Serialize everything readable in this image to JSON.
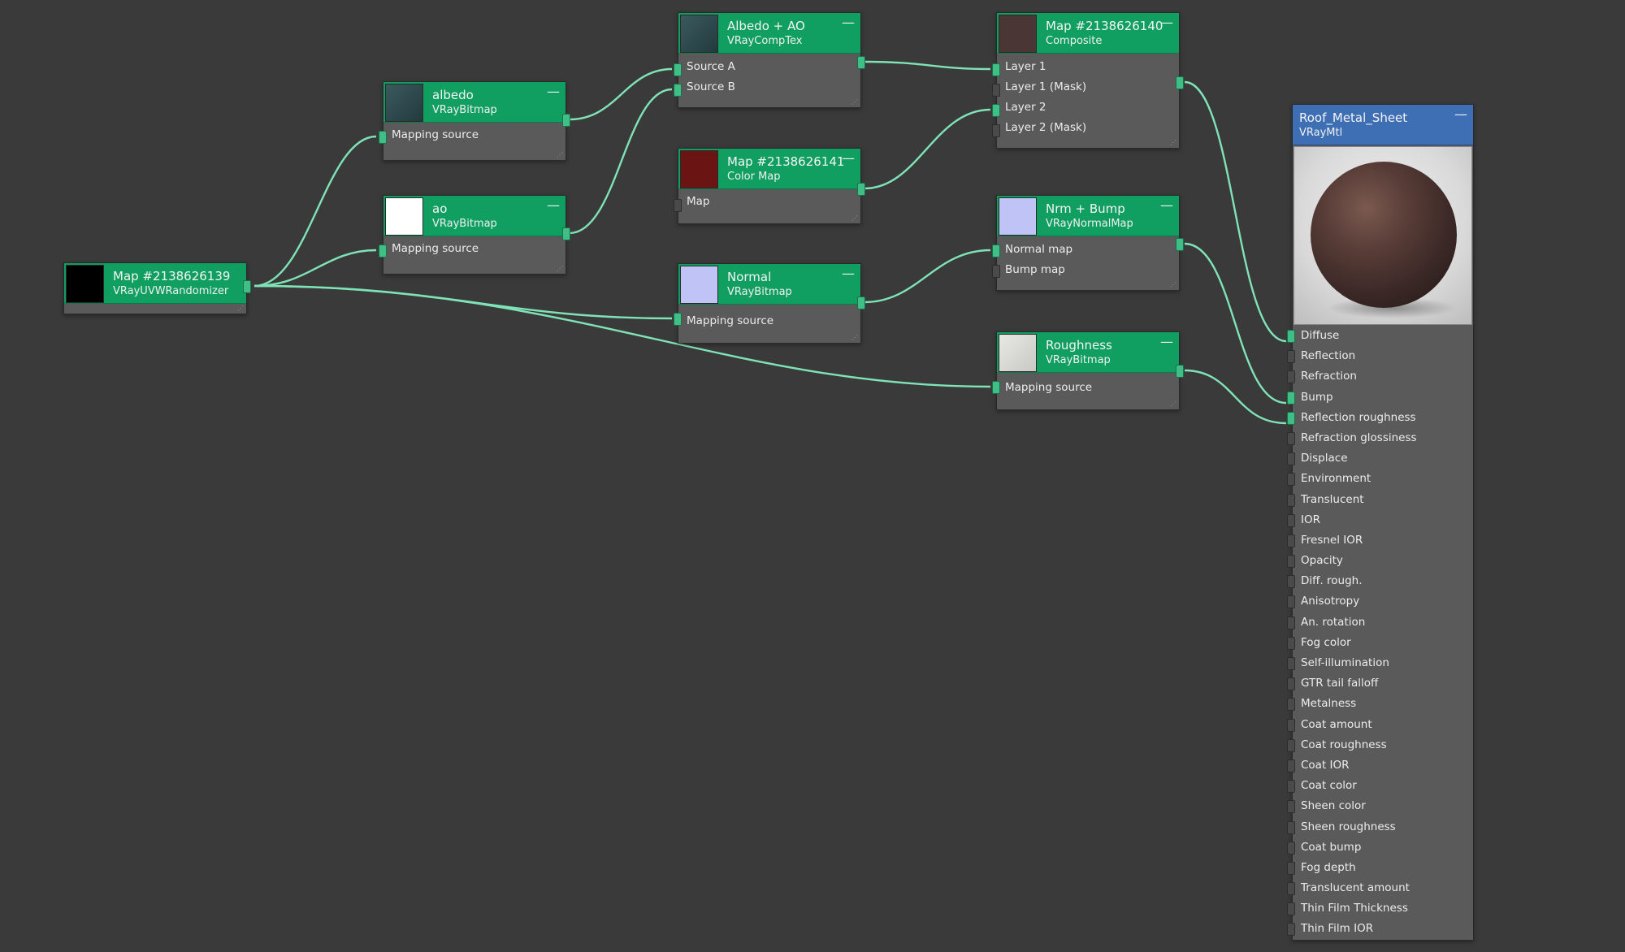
{
  "nodes": {
    "randomizer": {
      "title": "Map #2138626139",
      "subtitle": "VRayUVWRandomizer",
      "thumb": "#000000"
    },
    "albedo": {
      "title": "albedo",
      "subtitle": "VRayBitmap",
      "thumb": "#2f4b50",
      "slot": "Mapping source"
    },
    "ao": {
      "title": "ao",
      "subtitle": "VRayBitmap",
      "thumb": "#ffffff",
      "slot": "Mapping source"
    },
    "albedo_ao": {
      "title": "Albedo + AO",
      "subtitle": "VRayCompTex",
      "thumb": "#2d4a4f",
      "slots": [
        "Source A",
        "Source B"
      ]
    },
    "colormap": {
      "title": "Map #2138626141",
      "subtitle": "Color Map",
      "thumb": "#6b1414",
      "slot": "Map"
    },
    "normal": {
      "title": "Normal",
      "subtitle": "VRayBitmap",
      "thumb": "#bfc3f6",
      "slot": "Mapping source"
    },
    "composite": {
      "title": "Map #2138626140",
      "subtitle": "Composite",
      "thumb": "#4a3634",
      "slots": [
        "Layer 1",
        "Layer 1 (Mask)",
        "Layer 2",
        "Layer 2 (Mask)"
      ]
    },
    "nrmbump": {
      "title": "Nrm + Bump",
      "subtitle": "VRayNormalMap",
      "thumb": "#bfc3f6",
      "slots": [
        "Normal map",
        "Bump map"
      ]
    },
    "roughness": {
      "title": "Roughness",
      "subtitle": "VRayBitmap",
      "thumb": "#dcdcd8",
      "slot": "Mapping source"
    }
  },
  "material": {
    "title": "Roof_Metal_Sheet",
    "subtitle": "VRayMtl",
    "slots": [
      "Diffuse",
      "Reflection",
      "Refraction",
      "Bump",
      "Reflection roughness",
      "Refraction glossiness",
      "Displace",
      "Environment",
      "Translucent",
      "IOR",
      "Fresnel IOR",
      "Opacity",
      "Diff. rough.",
      "Anisotropy",
      "An. rotation",
      "Fog color",
      "Self-illumination",
      "GTR tail falloff",
      "Metalness",
      "Coat amount",
      "Coat roughness",
      "Coat IOR",
      "Coat color",
      "Sheen color",
      "Sheen roughness",
      "Coat bump",
      "Fog depth",
      "Translucent amount",
      "Thin Film Thickness",
      "Thin Film IOR"
    ]
  },
  "colors": {
    "background": "#3a3a3a",
    "node_header": "#109e61",
    "material_header": "#3e6fb4",
    "wire": "#7fe3b7"
  },
  "icons": {
    "minimize": "—"
  }
}
